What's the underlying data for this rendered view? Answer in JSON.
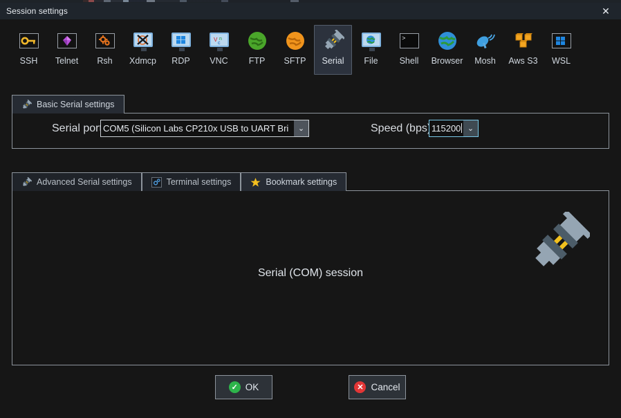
{
  "window": {
    "title": "Session settings",
    "close_icon": "close-icon",
    "close_glyph": "✕",
    "titlebar_color": "#1f252c",
    "background_color": "#161616"
  },
  "protocols": {
    "selected": "Serial",
    "items": [
      {
        "label": "SSH",
        "icon": "key-icon"
      },
      {
        "label": "Telnet",
        "icon": "gem-icon"
      },
      {
        "label": "Rsh",
        "icon": "gears-icon"
      },
      {
        "label": "Xdmcp",
        "icon": "x-window-monitor-icon"
      },
      {
        "label": "RDP",
        "icon": "windows-monitor-icon"
      },
      {
        "label": "VNC",
        "icon": "vnc-monitor-icon"
      },
      {
        "label": "FTP",
        "icon": "green-globe-icon"
      },
      {
        "label": "SFTP",
        "icon": "orange-globe-icon"
      },
      {
        "label": "Serial",
        "icon": "serial-plug-icon"
      },
      {
        "label": "File",
        "icon": "file-globe-monitor-icon"
      },
      {
        "label": "Shell",
        "icon": "terminal-prompt-icon"
      },
      {
        "label": "Browser",
        "icon": "blue-globe-icon"
      },
      {
        "label": "Mosh",
        "icon": "satellite-dish-icon"
      },
      {
        "label": "Aws S3",
        "icon": "aws-cubes-icon"
      },
      {
        "label": "WSL",
        "icon": "windows-logo-icon"
      }
    ]
  },
  "basic_panel": {
    "tab_label": "Basic Serial settings",
    "tab_icon": "serial-plug-icon",
    "serial_port": {
      "label": "Serial port *",
      "value": "COM5  (Silicon Labs CP210x USB to UART Bri",
      "arrow": "⌄"
    },
    "speed": {
      "label": "Speed (bps) *",
      "value": "115200",
      "arrow": "⌄",
      "focus_color": "#79c8e8"
    }
  },
  "settings_tabs": {
    "active_index": 2,
    "items": [
      {
        "label": "Advanced Serial settings",
        "icon": "serial-plug-icon"
      },
      {
        "label": "Terminal settings",
        "icon": "blue-gear-icon"
      },
      {
        "label": "Bookmark settings",
        "icon": "star-icon"
      }
    ]
  },
  "content": {
    "headline": "Serial (COM) session",
    "illustration_icon": "serial-plug-icon"
  },
  "buttons": {
    "ok": {
      "label": "OK",
      "icon": "check-circle-icon",
      "color": "#2eb44b",
      "glyph": "✓"
    },
    "cancel": {
      "label": "Cancel",
      "icon": "x-circle-icon",
      "color": "#e33636",
      "glyph": "✕"
    }
  }
}
